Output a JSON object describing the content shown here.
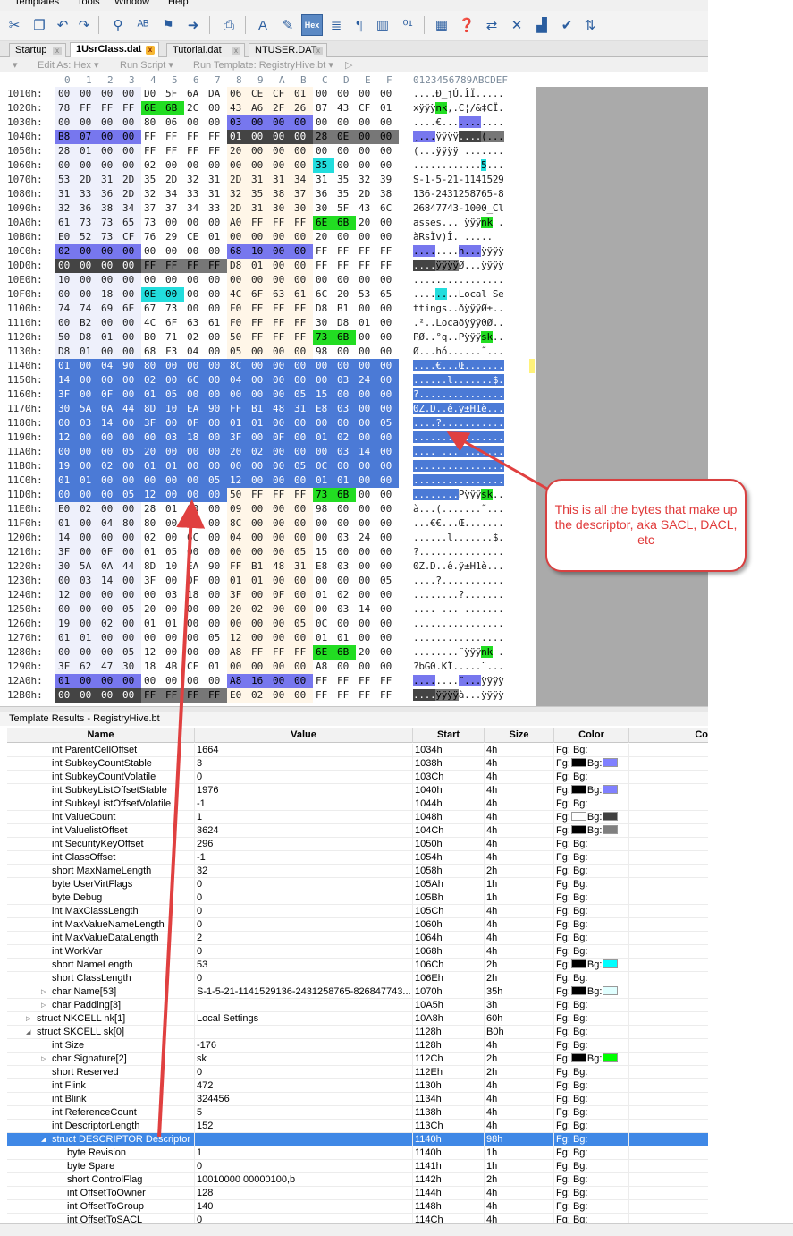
{
  "menubar": {
    "items": [
      "Templates",
      "Tools",
      "Window",
      "Help"
    ]
  },
  "toolbar": {
    "hex_button": "Hex"
  },
  "tabs": [
    {
      "label": "Startup",
      "active": false
    },
    {
      "label": "1UsrClass.dat",
      "active": true
    },
    {
      "label": "Tutorial.dat",
      "active": false
    },
    {
      "label": "NTUSER.DAT",
      "active": false
    }
  ],
  "subtoolbar": {
    "edit_as": "Edit As: Hex ▾",
    "run_script": "Run Script ▾",
    "run_template": "Run Template: RegistryHive.bt ▾"
  },
  "hex_editor": {
    "column_header": [
      "0",
      "1",
      "2",
      "3",
      "4",
      "5",
      "6",
      "7",
      "8",
      "9",
      "A",
      "B",
      "C",
      "D",
      "E",
      "F"
    ],
    "ascii_header": "0123456789ABCDEF",
    "rows": [
      {
        "addr": "1010h:",
        "bytes": "00 00 00 00 D0 5F 6A DA 06 CE CF 01 00 00 00 00",
        "ascii": "....Ð_jÚ.ÎÏ....."
      },
      {
        "addr": "1020h:",
        "bytes": "78 FF FF FF 6E 6B 2C 00 43 A6 2F 26 87 43 CF 01",
        "ascii": "xÿÿÿnk,.C¦/&‡CÏ."
      },
      {
        "addr": "1030h:",
        "bytes": "00 00 00 00 80 06 00 00 03 00 00 00 00 00 00 00",
        "ascii": "....€..........."
      },
      {
        "addr": "1040h:",
        "bytes": "B8 07 00 00 FF FF FF FF 01 00 00 00 28 0E 00 00",
        "ascii": "¸...ÿÿÿÿ....(..."
      },
      {
        "addr": "1050h:",
        "bytes": "28 01 00 00 FF FF FF FF 20 00 00 00 00 00 00 00",
        "ascii": "(...ÿÿÿÿ ......."
      },
      {
        "addr": "1060h:",
        "bytes": "00 00 00 00 02 00 00 00 00 00 00 00 35 00 00 00",
        "ascii": "............5..."
      },
      {
        "addr": "1070h:",
        "bytes": "53 2D 31 2D 35 2D 32 31 2D 31 31 34 31 35 32 39",
        "ascii": "S-1-5-21-1141529"
      },
      {
        "addr": "1080h:",
        "bytes": "31 33 36 2D 32 34 33 31 32 35 38 37 36 35 2D 38",
        "ascii": "136-2431258765-8"
      },
      {
        "addr": "1090h:",
        "bytes": "32 36 38 34 37 37 34 33 2D 31 30 30 30 5F 43 6C",
        "ascii": "26847743-1000_Cl"
      },
      {
        "addr": "10A0h:",
        "bytes": "61 73 73 65 73 00 00 00 A0 FF FF FF 6E 6B 20 00",
        "ascii": "asses... ÿÿÿnk ."
      },
      {
        "addr": "10B0h:",
        "bytes": "E0 52 73 CF 76 29 CE 01 00 00 00 00 20 00 00 00",
        "ascii": "àRsÏv)Î. ....."
      },
      {
        "addr": "10C0h:",
        "bytes": "02 00 00 00 00 00 00 00 68 10 00 00 FF FF FF FF",
        "ascii": "........h...ÿÿÿÿ"
      },
      {
        "addr": "10D0h:",
        "bytes": "00 00 00 00 FF FF FF FF D8 01 00 00 FF FF FF FF",
        "ascii": "....ÿÿÿÿØ...ÿÿÿÿ"
      },
      {
        "addr": "10E0h:",
        "bytes": "10 00 00 00 00 00 00 00 00 00 00 00 00 00 00 00",
        "ascii": "................"
      },
      {
        "addr": "10F0h:",
        "bytes": "00 00 18 00 0E 00 00 00 4C 6F 63 61 6C 20 53 65",
        "ascii": "........Local Se"
      },
      {
        "addr": "1100h:",
        "bytes": "74 74 69 6E 67 73 00 00 F0 FF FF FF D8 B1 00 00",
        "ascii": "ttings..ðÿÿÿØ±.."
      },
      {
        "addr": "1110h:",
        "bytes": "00 B2 00 00 4C 6F 63 61 F0 FF FF FF 30 D8 01 00",
        "ascii": ".²..Locaðÿÿÿ0Ø.."
      },
      {
        "addr": "1120h:",
        "bytes": "50 D8 01 00 B0 71 02 00 50 FF FF FF 73 6B 00 00",
        "ascii": "PØ..°q..Pÿÿÿsk.."
      },
      {
        "addr": "1130h:",
        "bytes": "D8 01 00 00 68 F3 04 00 05 00 00 00 98 00 00 00",
        "ascii": "Ø...hó......˜..."
      },
      {
        "addr": "1140h:",
        "bytes": "01 00 04 90 80 00 00 00 8C 00 00 00 00 00 00 00",
        "ascii": "....€...Œ......."
      },
      {
        "addr": "1150h:",
        "bytes": "14 00 00 00 02 00 6C 00 04 00 00 00 00 03 24 00",
        "ascii": "......l.......$."
      },
      {
        "addr": "1160h:",
        "bytes": "3F 00 0F 00 01 05 00 00 00 00 00 05 15 00 00 00",
        "ascii": "?..............."
      },
      {
        "addr": "1170h:",
        "bytes": "30 5A 0A 44 8D 10 EA 90 FF B1 48 31 E8 03 00 00",
        "ascii": "0Z.D..ê.ÿ±H1è..."
      },
      {
        "addr": "1180h:",
        "bytes": "00 03 14 00 3F 00 0F 00 01 01 00 00 00 00 00 05",
        "ascii": "....?..........."
      },
      {
        "addr": "1190h:",
        "bytes": "12 00 00 00 00 03 18 00 3F 00 0F 00 01 02 00 00",
        "ascii": "........?......."
      },
      {
        "addr": "11A0h:",
        "bytes": "00 00 00 05 20 00 00 00 20 02 00 00 00 03 14 00",
        "ascii": ".... ... ......."
      },
      {
        "addr": "11B0h:",
        "bytes": "19 00 02 00 01 01 00 00 00 00 00 05 0C 00 00 00",
        "ascii": "................"
      },
      {
        "addr": "11C0h:",
        "bytes": "01 01 00 00 00 00 00 05 12 00 00 00 01 01 00 00",
        "ascii": "................"
      },
      {
        "addr": "11D0h:",
        "bytes": "00 00 00 05 12 00 00 00 50 FF FF FF 73 6B 00 00",
        "ascii": "........Pÿÿÿsk.."
      },
      {
        "addr": "11E0h:",
        "bytes": "E0 02 00 00 28 01 00 00 09 00 00 00 98 00 00 00",
        "ascii": "à...(.......˜..."
      },
      {
        "addr": "11F0h:",
        "bytes": "01 00 04 80 80 00 00 00 8C 00 00 00 00 00 00 00",
        "ascii": "...€€...Œ......."
      },
      {
        "addr": "1200h:",
        "bytes": "14 00 00 00 02 00 6C 00 04 00 00 00 00 03 24 00",
        "ascii": "......l.......$."
      },
      {
        "addr": "1210h:",
        "bytes": "3F 00 0F 00 01 05 00 00 00 00 00 05 15 00 00 00",
        "ascii": "?..............."
      },
      {
        "addr": "1220h:",
        "bytes": "30 5A 0A 44 8D 10 EA 90 FF B1 48 31 E8 03 00 00",
        "ascii": "0Z.D..ê.ÿ±H1è..."
      },
      {
        "addr": "1230h:",
        "bytes": "00 03 14 00 3F 00 0F 00 01 01 00 00 00 00 00 05",
        "ascii": "....?..........."
      },
      {
        "addr": "1240h:",
        "bytes": "12 00 00 00 00 03 18 00 3F 00 0F 00 01 02 00 00",
        "ascii": "........?......."
      },
      {
        "addr": "1250h:",
        "bytes": "00 00 00 05 20 00 00 00 20 02 00 00 00 03 14 00",
        "ascii": ".... ... ......."
      },
      {
        "addr": "1260h:",
        "bytes": "19 00 02 00 01 01 00 00 00 00 00 05 0C 00 00 00",
        "ascii": "................"
      },
      {
        "addr": "1270h:",
        "bytes": "01 01 00 00 00 00 00 05 12 00 00 00 01 01 00 00",
        "ascii": "................"
      },
      {
        "addr": "1280h:",
        "bytes": "00 00 00 05 12 00 00 00 A8 FF FF FF 6E 6B 20 00",
        "ascii": "........¨ÿÿÿnk ."
      },
      {
        "addr": "1290h:",
        "bytes": "3F 62 47 30 18 4B CF 01 00 00 00 00 A8 00 00 00",
        "ascii": "?bG0.KÏ.....¨..."
      },
      {
        "addr": "12A0h:",
        "bytes": "01 00 00 00 00 00 00 00 A8 16 00 00 FF FF FF FF",
        "ascii": "........¨...ÿÿÿÿ"
      },
      {
        "addr": "12B0h:",
        "bytes": "00 00 00 00 FF FF FF FF E0 02 00 00 FF FF FF FF",
        "ascii": "....ÿÿÿÿà...ÿÿÿÿ"
      }
    ]
  },
  "template_results": {
    "title": "Template Results - RegistryHive.bt",
    "columns": {
      "name": "Name",
      "value": "Value",
      "start": "Start",
      "size": "Size",
      "color": "Color",
      "comment": "Co"
    },
    "rows": [
      {
        "name": "int ParentCellOffset",
        "value": "1664",
        "start": "1034h",
        "size": "4h",
        "indent": 2,
        "fg": "",
        "bg": ""
      },
      {
        "name": "int SubkeyCountStable",
        "value": "3",
        "start": "1038h",
        "size": "4h",
        "indent": 2,
        "fg": "#000000",
        "bg": "#8080ff"
      },
      {
        "name": "int SubkeyCountVolatile",
        "value": "0",
        "start": "103Ch",
        "size": "4h",
        "indent": 2,
        "fg": "",
        "bg": ""
      },
      {
        "name": "int SubkeyListOffsetStable",
        "value": "1976",
        "start": "1040h",
        "size": "4h",
        "indent": 2,
        "fg": "#000000",
        "bg": "#8080ff"
      },
      {
        "name": "int SubkeyListOffsetVolatile",
        "value": "-1",
        "start": "1044h",
        "size": "4h",
        "indent": 2,
        "fg": "",
        "bg": ""
      },
      {
        "name": "int ValueCount",
        "value": "1",
        "start": "1048h",
        "size": "4h",
        "indent": 2,
        "fg": "#ffffff",
        "bg": "#404040"
      },
      {
        "name": "int ValuelistOffset",
        "value": "3624",
        "start": "104Ch",
        "size": "4h",
        "indent": 2,
        "fg": "#000000",
        "bg": "#808080"
      },
      {
        "name": "int SecurityKeyOffset",
        "value": "296",
        "start": "1050h",
        "size": "4h",
        "indent": 2,
        "fg": "",
        "bg": ""
      },
      {
        "name": "int ClassOffset",
        "value": "-1",
        "start": "1054h",
        "size": "4h",
        "indent": 2,
        "fg": "",
        "bg": ""
      },
      {
        "name": "short MaxNameLength",
        "value": "32",
        "start": "1058h",
        "size": "2h",
        "indent": 2,
        "fg": "",
        "bg": ""
      },
      {
        "name": "byte UserVirtFlags",
        "value": "0",
        "start": "105Ah",
        "size": "1h",
        "indent": 2,
        "fg": "",
        "bg": ""
      },
      {
        "name": "byte Debug",
        "value": "0",
        "start": "105Bh",
        "size": "1h",
        "indent": 2,
        "fg": "",
        "bg": ""
      },
      {
        "name": "int MaxClassLength",
        "value": "0",
        "start": "105Ch",
        "size": "4h",
        "indent": 2,
        "fg": "",
        "bg": ""
      },
      {
        "name": "int MaxValueNameLength",
        "value": "0",
        "start": "1060h",
        "size": "4h",
        "indent": 2,
        "fg": "",
        "bg": ""
      },
      {
        "name": "int MaxValueDataLength",
        "value": "2",
        "start": "1064h",
        "size": "4h",
        "indent": 2,
        "fg": "",
        "bg": ""
      },
      {
        "name": "int WorkVar",
        "value": "0",
        "start": "1068h",
        "size": "4h",
        "indent": 2,
        "fg": "",
        "bg": ""
      },
      {
        "name": "short NameLength",
        "value": "53",
        "start": "106Ch",
        "size": "2h",
        "indent": 2,
        "fg": "#000000",
        "bg": "#00ffff"
      },
      {
        "name": "short ClassLength",
        "value": "0",
        "start": "106Eh",
        "size": "2h",
        "indent": 2,
        "fg": "",
        "bg": ""
      },
      {
        "name": "char Name[53]",
        "value": "S-1-5-21-1141529136-2431258765-826847743...",
        "start": "1070h",
        "size": "35h",
        "indent": 2,
        "expand": "closed",
        "fg": "#000000",
        "bg": "#e0ffff"
      },
      {
        "name": "char Padding[3]",
        "value": "",
        "start": "10A5h",
        "size": "3h",
        "indent": 2,
        "expand": "closed",
        "fg": "",
        "bg": ""
      },
      {
        "name": "struct NKCELL nk[1]",
        "value": "Local Settings",
        "start": "10A8h",
        "size": "60h",
        "indent": 1,
        "expand": "closed",
        "fg": "",
        "bg": ""
      },
      {
        "name": "struct SKCELL sk[0]",
        "value": "",
        "start": "1128h",
        "size": "B0h",
        "indent": 1,
        "expand": "open",
        "fg": "",
        "bg": ""
      },
      {
        "name": "int Size",
        "value": "-176",
        "start": "1128h",
        "size": "4h",
        "indent": 2,
        "fg": "",
        "bg": ""
      },
      {
        "name": "char Signature[2]",
        "value": "sk",
        "start": "112Ch",
        "size": "2h",
        "indent": 2,
        "expand": "closed",
        "fg": "#000000",
        "bg": "#00ff00"
      },
      {
        "name": "short Reserved",
        "value": "0",
        "start": "112Eh",
        "size": "2h",
        "indent": 2,
        "fg": "",
        "bg": ""
      },
      {
        "name": "int Flink",
        "value": "472",
        "start": "1130h",
        "size": "4h",
        "indent": 2,
        "fg": "",
        "bg": ""
      },
      {
        "name": "int Blink",
        "value": "324456",
        "start": "1134h",
        "size": "4h",
        "indent": 2,
        "fg": "",
        "bg": ""
      },
      {
        "name": "int ReferenceCount",
        "value": "5",
        "start": "1138h",
        "size": "4h",
        "indent": 2,
        "fg": "",
        "bg": ""
      },
      {
        "name": "int DescriptorLength",
        "value": "152",
        "start": "113Ch",
        "size": "4h",
        "indent": 2,
        "fg": "",
        "bg": ""
      },
      {
        "name": "struct DESCRIPTOR Descriptor",
        "value": "",
        "start": "1140h",
        "size": "98h",
        "indent": 2,
        "expand": "open",
        "selected": true,
        "fg": "",
        "bg": ""
      },
      {
        "name": "byte Revision",
        "value": "1",
        "start": "1140h",
        "size": "1h",
        "indent": 3,
        "fg": "",
        "bg": ""
      },
      {
        "name": "byte Spare",
        "value": "0",
        "start": "1141h",
        "size": "1h",
        "indent": 3,
        "fg": "",
        "bg": ""
      },
      {
        "name": "short ControlFlag",
        "value": "10010000 00000100,b",
        "start": "1142h",
        "size": "2h",
        "indent": 3,
        "fg": "",
        "bg": ""
      },
      {
        "name": "int OffsetToOwner",
        "value": "128",
        "start": "1144h",
        "size": "4h",
        "indent": 3,
        "fg": "",
        "bg": ""
      },
      {
        "name": "int OffsetToGroup",
        "value": "140",
        "start": "1148h",
        "size": "4h",
        "indent": 3,
        "fg": "",
        "bg": ""
      },
      {
        "name": "int OffsetToSACL",
        "value": "0",
        "start": "114Ch",
        "size": "4h",
        "indent": 3,
        "fg": "",
        "bg": ""
      }
    ],
    "fg_label": "Fg:",
    "bg_label": "Bg:"
  },
  "annotation": {
    "callout_text": "This is all the bytes that make up the descriptor, aka SACL, DACL, etc",
    "color": "#e03a3a"
  }
}
